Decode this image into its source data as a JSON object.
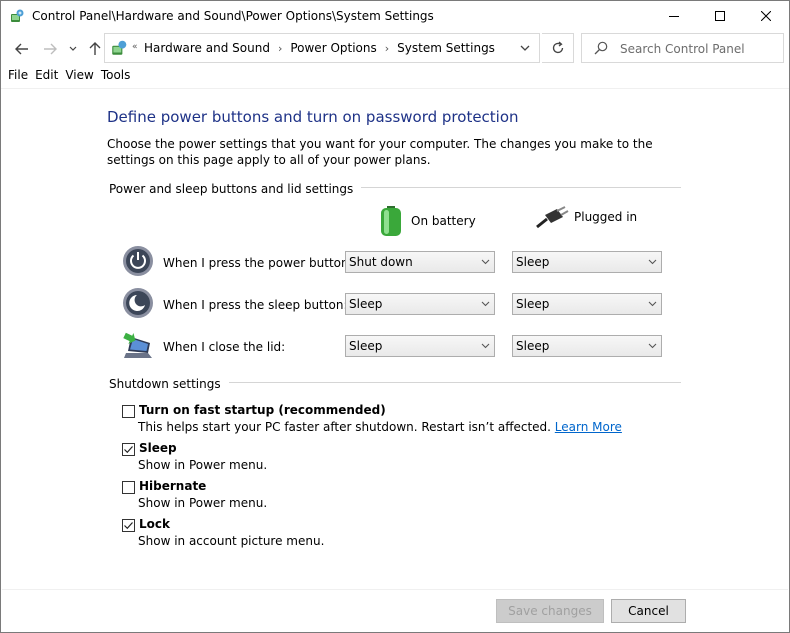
{
  "window": {
    "title": "Control Panel\\Hardware and Sound\\Power Options\\System Settings"
  },
  "address": {
    "crumbs": [
      "Hardware and Sound",
      "Power Options",
      "System Settings"
    ],
    "search_placeholder": "Search Control Panel"
  },
  "menu": [
    "File",
    "Edit",
    "View",
    "Tools"
  ],
  "main": {
    "title": "Define power buttons and turn on password protection",
    "intro": "Choose the power settings that you want for your computer. The changes you make to the settings on this page apply to all of your power plans.",
    "power_group_label": "Power and sleep buttons and lid settings",
    "col_battery": "On battery",
    "col_plugged": "Plugged in",
    "rows": [
      {
        "label": "When I press the power button:",
        "battery": "Shut down",
        "plugged": "Sleep",
        "icon": "power-button-icon"
      },
      {
        "label": "When I press the sleep button:",
        "battery": "Sleep",
        "plugged": "Sleep",
        "icon": "sleep-button-icon"
      },
      {
        "label": "When I close the lid:",
        "battery": "Sleep",
        "plugged": "Sleep",
        "icon": "laptop-lid-icon"
      }
    ],
    "shutdown_group_label": "Shutdown settings",
    "shutdown": [
      {
        "label": "Turn on fast startup (recommended)",
        "desc": "This helps start your PC faster after shutdown. Restart isn’t affected.",
        "link": "Learn More",
        "checked": false
      },
      {
        "label": "Sleep",
        "desc": "Show in Power menu.",
        "checked": true
      },
      {
        "label": "Hibernate",
        "desc": "Show in Power menu.",
        "checked": false
      },
      {
        "label": "Lock",
        "desc": "Show in account picture menu.",
        "checked": true
      }
    ]
  },
  "footer": {
    "save": "Save changes",
    "cancel": "Cancel"
  },
  "colors": {
    "title_blue": "#1e3287",
    "link_blue": "#0066cc"
  }
}
